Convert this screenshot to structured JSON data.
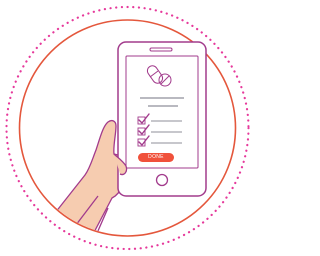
{
  "button": {
    "done_label": "DONE"
  },
  "checklist": {
    "items": [
      {
        "checked": true
      },
      {
        "checked": true
      },
      {
        "checked": true
      }
    ]
  },
  "icons": {
    "header": "pills-icon",
    "check": "checkmark-icon",
    "home": "home-button-icon"
  },
  "colors": {
    "ring_solid": "#e4573c",
    "ring_dotted": "#e6399b",
    "phone_outline": "#a23b8c",
    "check": "#a23b8c",
    "button": "#f0513b",
    "hand_fill": "#f6ccb0",
    "hand_outline": "#a23b8c",
    "lines": "#8f8f9a"
  }
}
